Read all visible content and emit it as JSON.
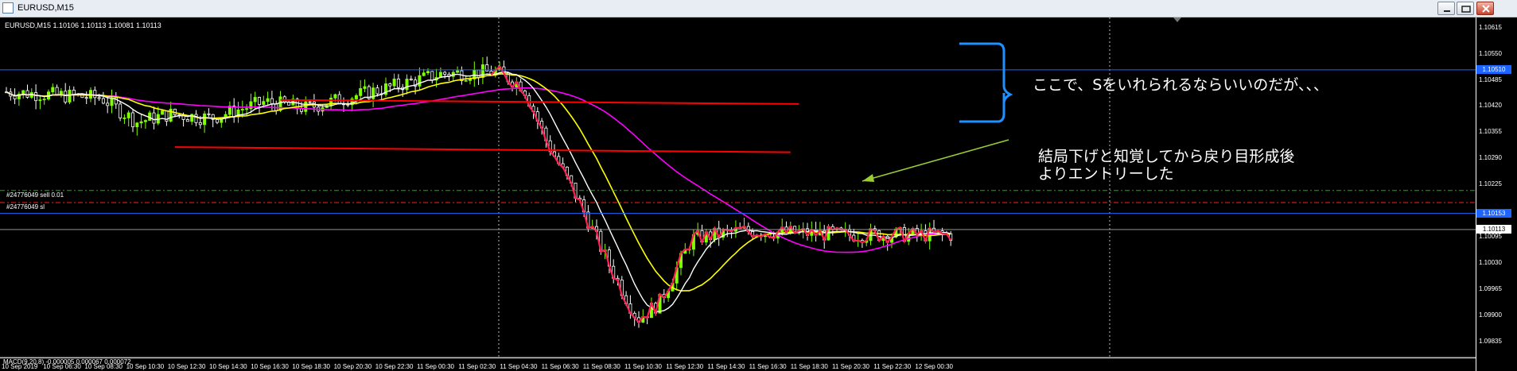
{
  "window": {
    "title": "EURUSD,M15",
    "buttons": {
      "minimize": "minimize-icon",
      "restore": "restore-icon",
      "close": "close-icon"
    }
  },
  "chart_label": "EURUSD,M15  1.10106 1.10113 1.10081 1.10113",
  "trades": [
    {
      "label": "#24776049 sell 0.01",
      "color": "#00c000"
    },
    {
      "label": "#24776049 sl",
      "color": "#ff2020"
    }
  ],
  "annotations": {
    "comment1": "ここで、Sをいれられるならいいのだが、、、",
    "comment2_line1": "結局下げと知覚してから戻り目形成後",
    "comment2_line2": "よりエントリーした"
  },
  "macd_label": "MACD(9,20,8) -0.000005 0.000067 0.000072",
  "colors": {
    "bull": "#7fff00",
    "bear": "#ffffff",
    "ma_fast": "#ffffff",
    "ma_mid": "#ffff00",
    "ma_slow": "#ff00ff",
    "zigzag": "#ff1e50",
    "hline": "#1e64ff",
    "resistance": "#ff0000",
    "bracket": "#1e90ff",
    "arrow": "#9acd32",
    "badge_blue": "#1e64ff"
  },
  "chart_data": {
    "type": "candlestick",
    "symbol": "EURUSD",
    "timeframe": "M15",
    "ohlc_last": {
      "open": 1.10106,
      "high": 1.10113,
      "low": 1.10081,
      "close": 1.10113
    },
    "ylim": [
      1.09795,
      1.1064
    ],
    "y_ticks": [
      "1.10615",
      "1.10550",
      "1.10485",
      "1.10420",
      "1.10355",
      "1.10290",
      "1.10225",
      "1.10153",
      "1.10095",
      "1.10030",
      "1.09965",
      "1.09900",
      "1.09835"
    ],
    "price_badges": [
      {
        "label": "1.10510",
        "kind": "hline"
      },
      {
        "label": "1.10153",
        "kind": "hline"
      },
      {
        "label": "1.10113",
        "kind": "current"
      }
    ],
    "x_ticks": [
      "10 Sep 2019",
      "10 Sep 06:30",
      "10 Sep 08:30",
      "10 Sep 10:30",
      "10 Sep 12:30",
      "10 Sep 14:30",
      "10 Sep 16:30",
      "10 Sep 18:30",
      "10 Sep 20:30",
      "10 Sep 22:30",
      "11 Sep 00:30",
      "11 Sep 02:30",
      "11 Sep 04:30",
      "11 Sep 06:30",
      "11 Sep 08:30",
      "11 Sep 10:30",
      "11 Sep 12:30",
      "11 Sep 14:30",
      "11 Sep 16:30",
      "11 Sep 18:30",
      "11 Sep 20:30",
      "11 Sep 22:30",
      "12 Sep 00:30"
    ],
    "horizontal_lines": [
      1.1051,
      1.10153,
      1.10113
    ],
    "trade_levels": {
      "sell_entry": 1.1021,
      "stop_loss": 1.1018
    },
    "resistance_lines": [
      {
        "from_index": 65,
        "to_index": 188,
        "from_price": 1.10435,
        "to_price": 1.10425
      },
      {
        "from_index": 40,
        "to_index": 186,
        "from_price": 1.10318,
        "to_price": 1.10305
      }
    ],
    "candles": 225
  }
}
